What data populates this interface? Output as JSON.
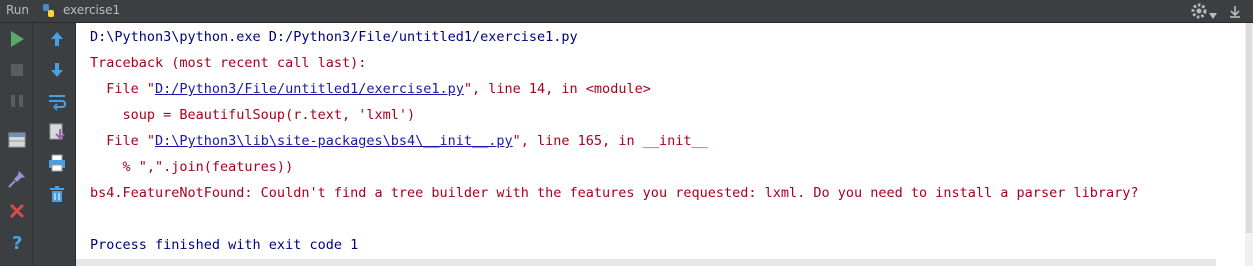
{
  "window": {
    "run_label": "Run",
    "config_name": "exercise1"
  },
  "toolbar_left": [
    "rerun-icon",
    "stop-icon",
    "pause-icon",
    "layout-icon",
    "pin-icon",
    "close-icon",
    "help-icon"
  ],
  "toolbar_right": [
    "up-arrow-icon",
    "down-arrow-icon",
    "soft-wrap-icon",
    "scroll-to-end-icon",
    "print-icon",
    "trash-icon"
  ],
  "console": {
    "command": "D:\\Python3\\python.exe D:/Python3/File/untitled1/exercise1.py",
    "traceback_header": "Traceback (most recent call last):",
    "frame1": {
      "prefix": "  File \"",
      "path": "D:/Python3/File/untitled1/exercise1.py",
      "suffix": "\", line 14, in <module>"
    },
    "frame1_code": "    soup = BeautifulSoup(r.text, 'lxml')",
    "frame2": {
      "prefix": "  File \"",
      "path": "D:\\Python3\\lib\\site-packages\\bs4\\__init__.py",
      "suffix": "\", line 165, in __init__"
    },
    "frame2_code": "    % \",\".join(features))",
    "error": "bs4.FeatureNotFound: Couldn't find a tree builder with the features you requested: lxml. Do you need to install a parser library?",
    "finish": "Process finished with exit code 1"
  },
  "colors": {
    "command": "#000080",
    "error": "#a9001c",
    "link": "#1a1aa6",
    "run_green": "#59a869"
  }
}
